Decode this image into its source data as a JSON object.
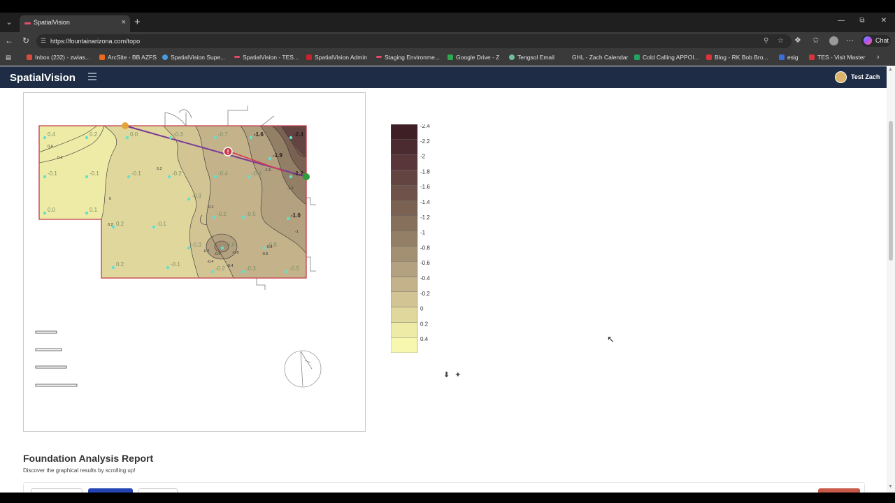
{
  "browser": {
    "tab_title": "SpatialVision",
    "url": "https://fountainarizona.com/topo",
    "chat_label": "Chat",
    "bookmarks": [
      "Inbox (232) - zwias...",
      "ArcSite - BB AZFS",
      "SpatialVision Supe...",
      "SpatialVision - TES...",
      "SpatialVision Admin",
      "Staging Environme...",
      "Google Drive - Z",
      "Tengsol Email",
      "GHL - Zach Calendar",
      "Cold Calling APPOI...",
      "Blog - RK Bob Bro...",
      "esig",
      "TES - Visit Master"
    ]
  },
  "app": {
    "brand": "SpatialVision",
    "user_name": "Test Zach"
  },
  "map": {
    "point_labels": [
      {
        "v": "0.4"
      },
      {
        "v": "0.2"
      },
      {
        "v": "0.0"
      },
      {
        "v": "-0.3"
      },
      {
        "v": "-0.7"
      },
      {
        "v": "-1.6"
      },
      {
        "v": "-2.4"
      },
      {
        "v": "-1.9"
      },
      {
        "v": "-0.1"
      },
      {
        "v": "-0.1"
      },
      {
        "v": "-0.1"
      },
      {
        "v": "-0.2"
      },
      {
        "v": "-0.4"
      },
      {
        "v": "-0.4"
      },
      {
        "v": "-0.3"
      },
      {
        "v": "-1.2"
      },
      {
        "v": "0.0"
      },
      {
        "v": "0.1"
      },
      {
        "v": "0.2"
      },
      {
        "v": "-0.1"
      },
      {
        "v": "-0.2"
      },
      {
        "v": "-0.5"
      },
      {
        "v": "-1.0"
      },
      {
        "v": "-0.3"
      },
      {
        "v": "-0.8"
      },
      {
        "v": "-0.8"
      },
      {
        "v": "0.2"
      },
      {
        "v": "-0.1"
      },
      {
        "v": "-0.2"
      },
      {
        "v": "-0.3"
      },
      {
        "v": "-0.5"
      }
    ],
    "contour_labels": [
      "0.4",
      "0.2",
      "0.2",
      "0",
      "-0.2",
      "-0.4",
      "-0.6",
      "-0.8",
      "-1",
      "-1.3",
      "-1.5",
      "-0.8",
      "-0.6",
      "-0.4",
      "-0.2",
      "0.2"
    ],
    "marker_label": "!"
  },
  "legend": {
    "labels": [
      "-2.4",
      "-2.2",
      "-2",
      "-1.8",
      "-1.6",
      "-1.4",
      "-1.2",
      "-1",
      "-0.8",
      "-0.6",
      "-0.4",
      "-0.2",
      "0",
      "0.2",
      "0.4"
    ],
    "colors": [
      "#3f1f26",
      "#4b2a30",
      "#58363a",
      "#634441",
      "#6e524a",
      "#7a6152",
      "#86705c",
      "#937f66",
      "#a38f72",
      "#b3a17f",
      "#c3b28a",
      "#d2c493",
      "#e0d79c",
      "#eeeba6",
      "#f7f7b0"
    ]
  },
  "tools": {
    "download_icon": "download-icon",
    "collapse_icon": "collapse-icon"
  },
  "report": {
    "title": "Foundation Analysis Report",
    "subtitle": "Discover the graphical results by scrolling up!"
  }
}
